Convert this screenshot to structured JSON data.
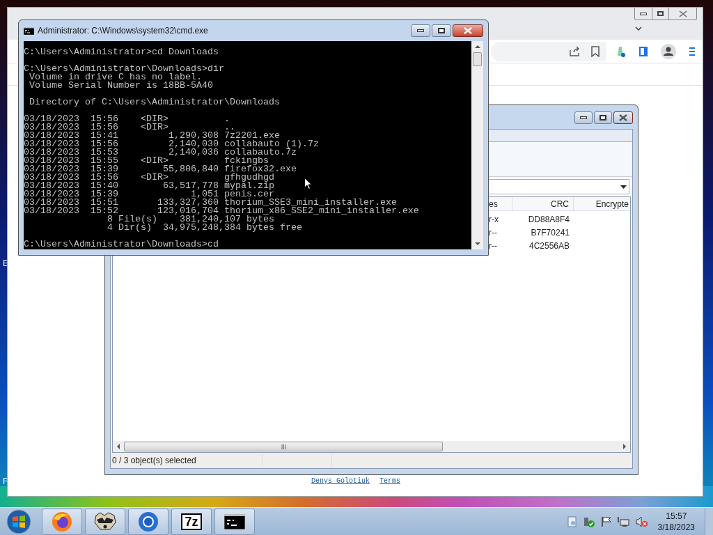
{
  "desktop": {
    "icon_labels": [
      "E",
      "F"
    ]
  },
  "browser": {
    "links": [
      "Denys Golotiuk",
      "Terms"
    ]
  },
  "archive_window": {
    "columns": [
      "es",
      "CRC",
      "Encrypte"
    ],
    "rows": [
      {
        "attributes": "r-x",
        "crc": "DD88A8F4"
      },
      {
        "attributes": "r--",
        "crc": "B7F70241"
      },
      {
        "attributes": "r--",
        "crc": "4C2556AB"
      }
    ],
    "status": "0 / 3 object(s) selected"
  },
  "console_window": {
    "title": "Administrator: C:\\Windows\\system32\\cmd.exe",
    "blocks": [
      [
        "C:\\Users\\Administrator>cd Downloads"
      ],
      [
        "C:\\Users\\Administrator\\Downloads>dir",
        " Volume in drive C has no label.",
        " Volume Serial Number is 18BB-5A40"
      ],
      [
        " Directory of C:\\Users\\Administrator\\Downloads"
      ],
      [
        "03/18/2023  15:56    <DIR>          .",
        "03/18/2023  15:56    <DIR>          ..",
        "03/18/2023  15:41         1,290,308 7z2201.exe",
        "03/18/2023  15:56         2,140,030 collabauto (1).7z",
        "03/18/2023  15:53         2,140,036 collabauto.7z",
        "03/18/2023  15:55    <DIR>          fckingbs",
        "03/18/2023  15:39        55,806,840 firefox32.exe",
        "03/18/2023  15:56    <DIR>          gfhgudhgd",
        "03/18/2023  15:40        63,517,778 mypal.zip",
        "03/18/2023  15:39             1,051 penis.cer",
        "03/18/2023  15:51       133,327,360 thorium_SSE3_mini_installer.exe",
        "03/18/2023  15:52       123,016,704 thorium_x86_SSE2_mini_installer.exe",
        "               8 File(s)    381,240,107 bytes",
        "               4 Dir(s)  34,975,248,384 bytes free"
      ],
      [
        "C:\\Users\\Administrator\\Downloads>cd"
      ]
    ]
  },
  "taskbar": {
    "apps": [
      {
        "kind": "browser"
      },
      {
        "kind": "raccoon"
      },
      {
        "kind": "ring"
      },
      {
        "kind": "archive",
        "label": "7z"
      },
      {
        "kind": "terminal"
      }
    ],
    "clock": {
      "time": "15:57",
      "date": "3/18/2023"
    }
  }
}
